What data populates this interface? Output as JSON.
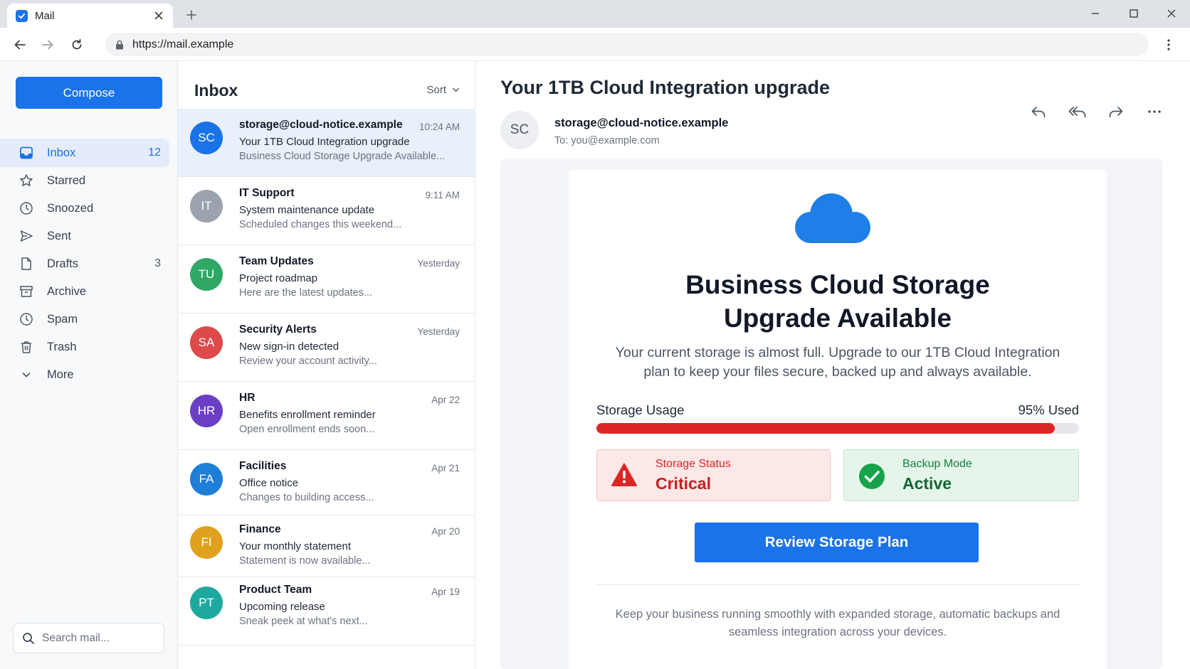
{
  "browser": {
    "tab_title": "Mail",
    "url": "https://mail.example"
  },
  "sidebar": {
    "compose_label": "Compose",
    "items": [
      {
        "label": "Inbox",
        "count": "12",
        "icon": "inbox-icon",
        "active": true
      },
      {
        "label": "Starred",
        "count": "",
        "icon": "star-icon"
      },
      {
        "label": "Snoozed",
        "count": "",
        "icon": "clock-icon"
      },
      {
        "label": "Sent",
        "count": "",
        "icon": "send-icon"
      },
      {
        "label": "Drafts",
        "count": "3",
        "icon": "draft-icon"
      },
      {
        "label": "Archive",
        "count": "",
        "icon": "archive-icon"
      },
      {
        "label": "Spam",
        "count": "",
        "icon": "spam-icon"
      },
      {
        "label": "Trash",
        "count": "",
        "icon": "trash-icon"
      },
      {
        "label": "More",
        "count": "",
        "icon": "chevron-down-icon"
      }
    ],
    "search_placeholder": "Search mail..."
  },
  "list": {
    "title": "Inbox",
    "sort_label": "Sort",
    "messages": [
      {
        "initials": "SC",
        "color": "#1a73e8",
        "sender": "storage@cloud-notice.example",
        "time": "10:24 AM",
        "subject": "Your 1TB Cloud Integration upgrade",
        "preview": "Business Cloud Storage Upgrade Available...",
        "selected": true
      },
      {
        "initials": "IT",
        "color": "#9ca3af",
        "sender": "IT Support",
        "time": "9:11 AM",
        "subject": "System maintenance update",
        "preview": "Scheduled changes this weekend..."
      },
      {
        "initials": "TU",
        "color": "#2fa866",
        "sender": "Team Updates",
        "time": "Yesterday",
        "subject": "Project roadmap",
        "preview": "Here are the latest updates..."
      },
      {
        "initials": "SA",
        "color": "#dc4a4a",
        "sender": "Security Alerts",
        "time": "Yesterday",
        "subject": "New sign-in detected",
        "preview": "Review your account activity..."
      },
      {
        "initials": "HR",
        "color": "#6a3fc4",
        "sender": "HR",
        "time": "Apr 22",
        "subject": "Benefits enrollment reminder",
        "preview": "Open enrollment ends soon..."
      },
      {
        "initials": "FA",
        "color": "#1f7fd6",
        "sender": "Facilities",
        "time": "Apr 21",
        "subject": "Office notice",
        "preview": "Changes to building access..."
      },
      {
        "initials": "FI",
        "color": "#e0a21e",
        "sender": "Finance",
        "time": "Apr 20",
        "subject": "Your monthly statement",
        "preview": "Statement is now available..."
      },
      {
        "initials": "PT",
        "color": "#1fa8a0",
        "sender": "Product Team",
        "time": "Apr 19",
        "subject": "Upcoming release",
        "preview": "Sneak peek at what's next..."
      }
    ]
  },
  "email": {
    "subject": "Your 1TB Cloud Integration upgrade",
    "avatar_initials": "SC",
    "from": "storage@cloud-notice.example",
    "to": "To: you@example.com",
    "headline_line1": "Business Cloud Storage",
    "headline_line2": "Upgrade Available",
    "lead": "Your current storage is almost full. Upgrade to our 1TB Cloud Integration plan to keep your files secure, backed up and always available.",
    "usage_label": "Storage Usage",
    "usage_text": "95% Used",
    "usage_fraction": 0.95,
    "status_caption": "Storage Status",
    "status_value": "Critical",
    "backup_caption": "Backup Mode",
    "backup_value": "Active",
    "cta_label": "Review Storage Plan",
    "footer": "Keep your business running smoothly with expanded storage, automatic backups and seamless integration across your devices."
  },
  "colors": {
    "accent": "#1a73e8",
    "critical": "#dc2626",
    "success": "#16a34a"
  }
}
